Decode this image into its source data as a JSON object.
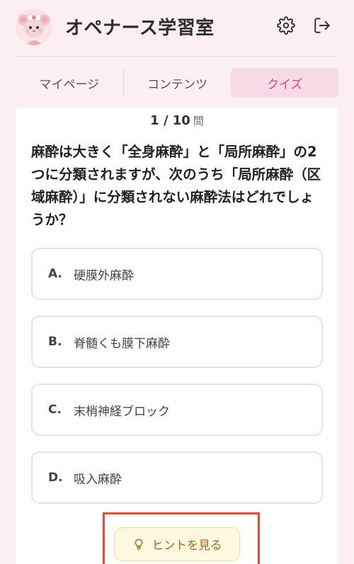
{
  "header": {
    "title": "オペナース学習室",
    "avatar_icon": "nurse-mouse-mascot",
    "settings_icon": "gear-icon",
    "logout_icon": "logout-icon"
  },
  "tabs": [
    {
      "label": "マイページ",
      "active": false
    },
    {
      "label": "コンテンツ",
      "active": false
    },
    {
      "label": "クイズ",
      "active": true
    }
  ],
  "quiz": {
    "current": "1",
    "total": "10",
    "unit": "問",
    "question": "麻酔は大きく「全身麻酔」と「局所麻酔」の2つに分類されますが、次のうち「局所麻酔（区域麻酔）」に分類されない麻酔法はどれでしょうか？",
    "options": [
      {
        "letter": "A.",
        "text": "硬膜外麻酔"
      },
      {
        "letter": "B.",
        "text": "脊髄くも膜下麻酔"
      },
      {
        "letter": "C.",
        "text": "末梢神経ブロック"
      },
      {
        "letter": "D.",
        "text": "吸入麻酔"
      }
    ],
    "hint_label": "ヒントを見る",
    "hint_icon": "lightbulb-icon"
  },
  "colors": {
    "background": "#fbeff4",
    "accent": "#d0488e",
    "hint_text": "#a0671d",
    "highlight_box": "#e04a34"
  }
}
